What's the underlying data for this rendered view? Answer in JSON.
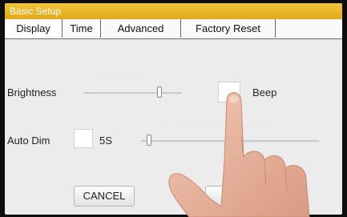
{
  "window": {
    "title": "Basic Setup"
  },
  "tabs": [
    {
      "label": "Display",
      "active": true
    },
    {
      "label": "Time",
      "active": false
    },
    {
      "label": "Advanced",
      "active": false
    },
    {
      "label": "Factory Reset",
      "active": false
    }
  ],
  "settings": {
    "brightness_label": "Brightness",
    "beep_label": "Beep",
    "auto_dim_label": "Auto Dim",
    "auto_dim_value": "5S"
  },
  "buttons": {
    "cancel_label": "CANCEL"
  },
  "colors": {
    "title_bar": "#e8b52a",
    "screen_bg": "#ececec"
  }
}
